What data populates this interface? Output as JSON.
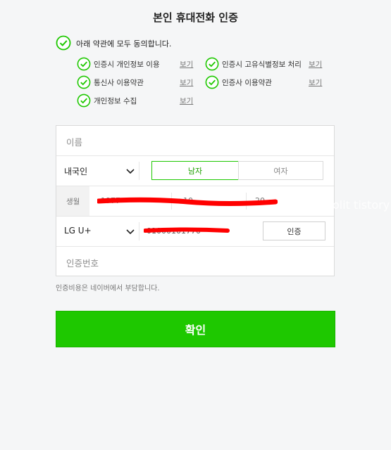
{
  "title": "본인 휴대전화 인증",
  "agree_all": "아래 약관에 모두 동의합니다.",
  "view": "보기",
  "terms": [
    "인증시 개인정보 이용",
    "인증시 고유식별정보 처리",
    "통신사 이용약관",
    "인증사 이용약관",
    "개인정보 수집"
  ],
  "form": {
    "name_placeholder": "이름",
    "nationality": "내국인",
    "gender_male": "남자",
    "gender_female": "여자",
    "birth_label": "생월",
    "birth_year": "1977",
    "birth_month": "10",
    "birth_day": "20",
    "carrier": "LG U+",
    "phone": "01000101770",
    "auth_button": "인증",
    "code_placeholder": "인증번호"
  },
  "note": "인증비용은 네이버에서 부담합니다.",
  "confirm": "확인",
  "watermark": "olit tistory",
  "colors": {
    "accent": "#1ec800",
    "redaction": "#ff0000"
  }
}
